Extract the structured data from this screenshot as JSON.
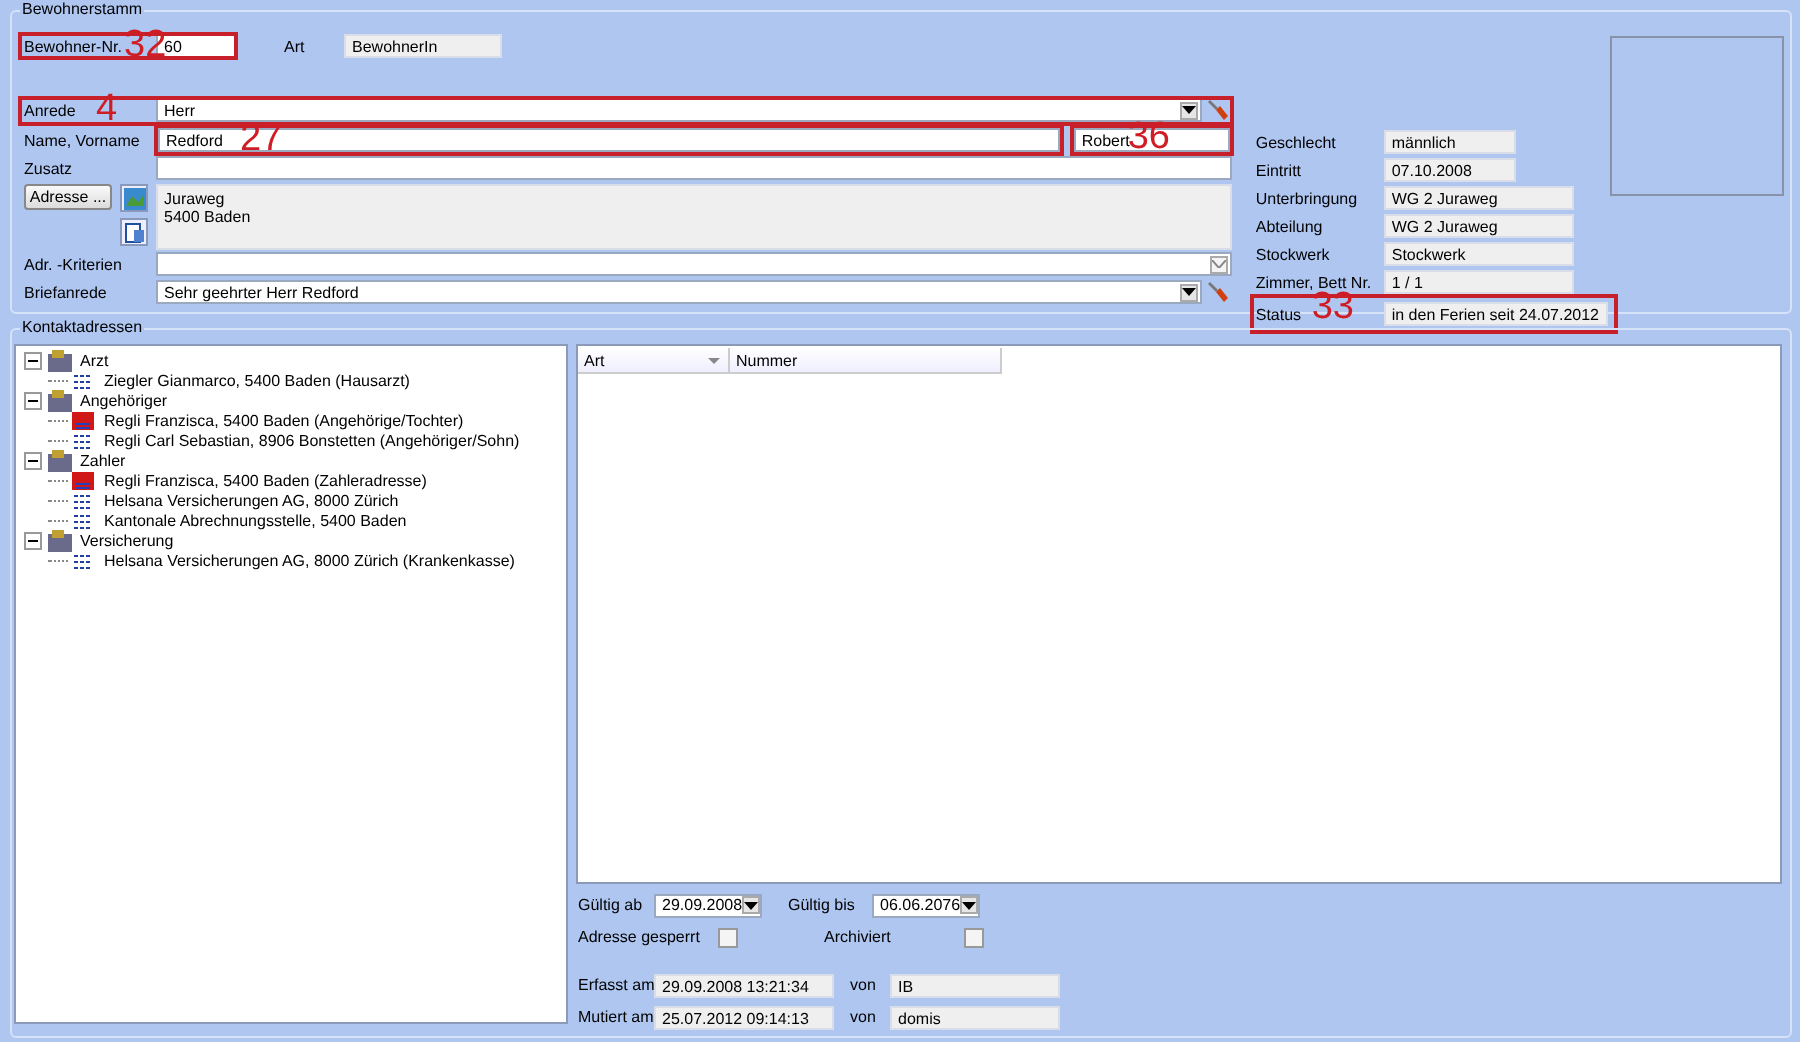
{
  "stammdaten": {
    "title": "Bewohnerstamm",
    "bewohner_nr": {
      "label": "Bewohner-Nr.",
      "value": "60",
      "callout": "32"
    },
    "art": {
      "label": "Art",
      "value": "BewohnerIn"
    },
    "anrede": {
      "label": "Anrede",
      "value": "Herr",
      "callout": "4"
    },
    "name": {
      "label": "Name, Vorname",
      "value": "Redford",
      "callout": "27"
    },
    "vorname": {
      "value": "Robert",
      "callout": "36"
    },
    "zusatz": {
      "label": "Zusatz"
    },
    "adresse_button": "Adresse ...",
    "address_lines": [
      "Juraweg",
      "5400 Baden"
    ],
    "adr_kriterien": {
      "label": "Adr. -Kriterien"
    },
    "briefanrede": {
      "label": "Briefanrede",
      "value": "Sehr geehrter Herr Redford"
    },
    "details": [
      {
        "label": "Geschlecht",
        "value": "männlich",
        "kind": "short"
      },
      {
        "label": "Eintritt",
        "value": "07.10.2008",
        "kind": "short"
      },
      {
        "label": "Unterbringung",
        "value": "WG 2 Juraweg",
        "kind": "long"
      },
      {
        "label": "Abteilung",
        "value": "WG 2 Juraweg",
        "kind": "long"
      },
      {
        "label": "Stockwerk",
        "value": "Stockwerk",
        "kind": "long"
      },
      {
        "label": "Zimmer, Bett Nr.",
        "value": "1 / 1",
        "kind": "long"
      },
      {
        "label": "Status",
        "value": "in den Ferien seit 24.07.2012",
        "kind": "long",
        "callout": "33"
      }
    ]
  },
  "kontaktadressen": {
    "title": "Kontaktadressen",
    "tree": [
      {
        "label": "Arzt",
        "expanded": true,
        "children": [
          {
            "label": "Ziegler Gianmarco, 5400 Baden (Hausarzt)",
            "kind": "other"
          }
        ]
      },
      {
        "label": "Angehöriger",
        "expanded": true,
        "children": [
          {
            "label": "Regli Franzisca, 5400 Baden (Angehörige/Tochter)",
            "kind": "main"
          },
          {
            "label": "Regli Carl Sebastian, 8906 Bonstetten (Angehöriger/Sohn)",
            "kind": "other"
          }
        ]
      },
      {
        "label": "Zahler",
        "expanded": true,
        "children": [
          {
            "label": "Regli Franzisca, 5400 Baden (Zahleradresse)",
            "kind": "main"
          },
          {
            "label": "Helsana Versicherungen AG, 8000 Zürich",
            "kind": "other"
          },
          {
            "label": "Kantonale Abrechnungsstelle, 5400 Baden",
            "kind": "other"
          }
        ]
      },
      {
        "label": "Versicherung",
        "expanded": true,
        "children": [
          {
            "label": "Helsana Versicherungen AG, 8000 Zürich (Krankenkasse)",
            "kind": "other"
          }
        ]
      }
    ],
    "list_columns": [
      "Art",
      "Nummer"
    ],
    "gueltig_ab": {
      "label": "Gültig ab",
      "value": "29.09.2008"
    },
    "gueltig_bis": {
      "label": "Gültig bis",
      "value": "06.06.2076"
    },
    "adresse_gesperrt": {
      "label": "Adresse gesperrt",
      "checked": false
    },
    "archiviert": {
      "label": "Archiviert",
      "checked": false
    },
    "erfasst": {
      "label": "Erfasst am",
      "value": "29.09.2008 13:21:34",
      "von_label": "von",
      "von": "IB"
    },
    "mutiert": {
      "label": "Mutiert am",
      "value": "25.07.2012 09:14:13",
      "von_label": "von",
      "von": "domis"
    }
  }
}
